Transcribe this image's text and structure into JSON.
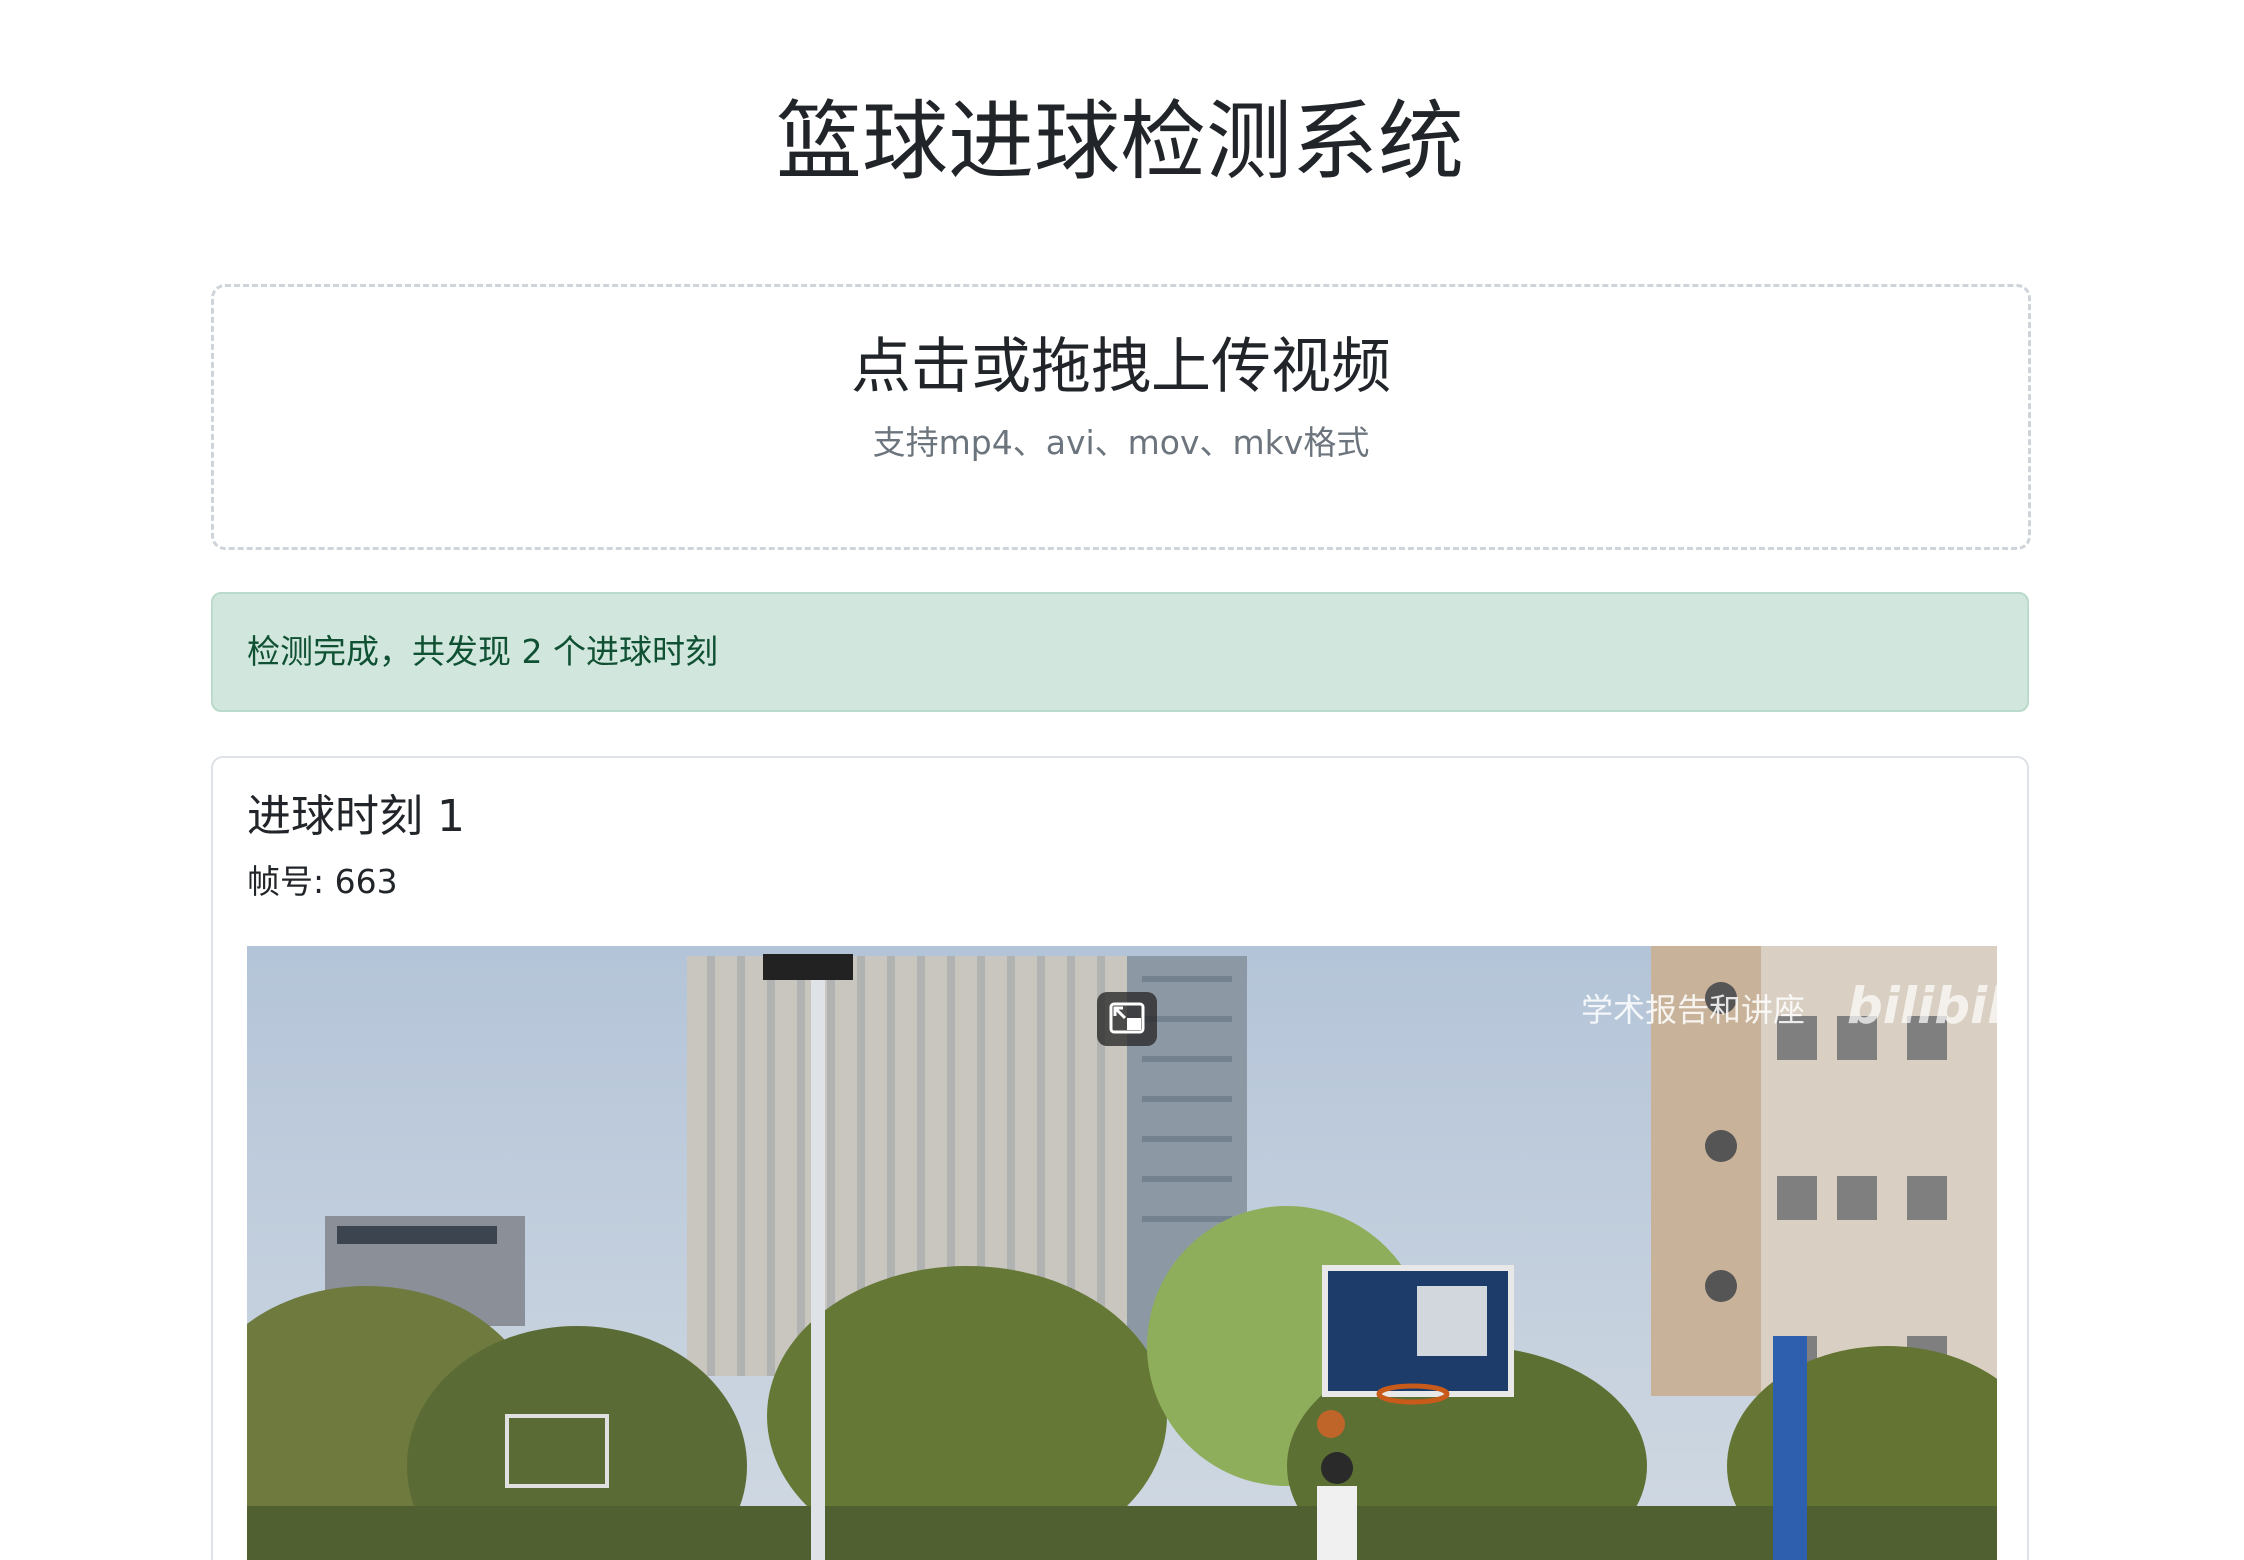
{
  "header": {
    "title": "篮球进球检测系统"
  },
  "upload": {
    "title": "点击或拖拽上传视频",
    "hint": "支持mp4、avi、mov、mkv格式"
  },
  "alert": {
    "message": "检测完成，共发现 2 个进球时刻"
  },
  "result": {
    "title": "进球时刻 1",
    "frame_label": "帧号: 663"
  },
  "video_frame": {
    "watermark": "学术报告和讲座",
    "logo_text": "bilibili"
  },
  "colors": {
    "alert_bg": "#d1e7dd",
    "alert_text": "#0f5132",
    "upload_border": "#ced4da",
    "hint_text": "#6c757d"
  },
  "icons": {
    "pip": "picture-in-picture-icon"
  }
}
